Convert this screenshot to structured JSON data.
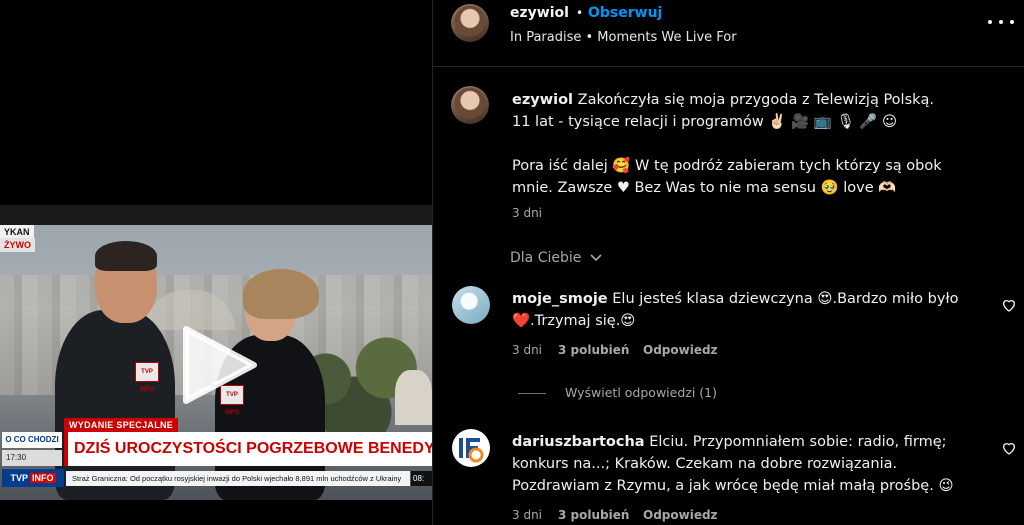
{
  "media": {
    "label_top": "YKAN",
    "label_live": "ŻYWO",
    "special_label": "WYDANIE SPECJALNE",
    "headline": "DZIŚ UROCZYSTOŚCI POGRZEBOWE BENEDYKTA XVI",
    "logo_text": "O CO CHODZI",
    "clock": "17:30",
    "channel": "TVP",
    "channel_badge": "INFO",
    "news_ticker": "Straż Graniczna: Od początku rosyjskiej inwazji do Polski wjechało 8,891 mln uchodźców z Ukrainy",
    "ticker_time": "08:",
    "mic_label": "TVP INFO"
  },
  "header": {
    "username": "ezywiol",
    "separator": "•",
    "follow_label": "Obserwuj",
    "audio": "In Paradise • Moments We Live For"
  },
  "caption": {
    "username": "ezywiol",
    "line1": "Zakończyła się moja przygoda z Telewizją Polską.",
    "line2": "11 lat - tysiące relacji i programów ✌🏻 🎥 📺 🎙 🎤 ☺",
    "line3": "Pora iść dalej 🥰  W tę podróż zabieram tych którzy są obok mnie. Zawsze ♥ Bez Was to nie ma sensu 🥹  love 🫶🏻",
    "time": "3 dni"
  },
  "for_you_label": "Dla Ciebie",
  "comments": [
    {
      "username": "moje_smoje",
      "text": "Elu jesteś klasa dziewczyna 😍.Bardzo miło było ❤️.Trzymaj się.😍",
      "time": "3 dni",
      "likes": "3 polubień",
      "reply": "Odpowiedz",
      "view_replies": "Wyświetl odpowiedzi (1)"
    },
    {
      "username": "dariuszbartocha",
      "text": "Elciu. Przypomniałem sobie: radio, firmę; konkurs na...; Kraków. Czekam na dobre rozwiązania. Pozdrawiam z Rzymu, a jak wrócę będę miał małą prośbę. 😉",
      "time": "3 dni",
      "likes": "3 polubień",
      "reply": "Odpowiedz"
    }
  ],
  "colors": {
    "accent": "#0095f6",
    "secondary_text": "#a8a8a8",
    "divider": "#262626",
    "tv_red": "#cc0000"
  },
  "icons": [
    "play-icon",
    "more-options-icon",
    "heart-icon",
    "chevron-down-icon"
  ]
}
